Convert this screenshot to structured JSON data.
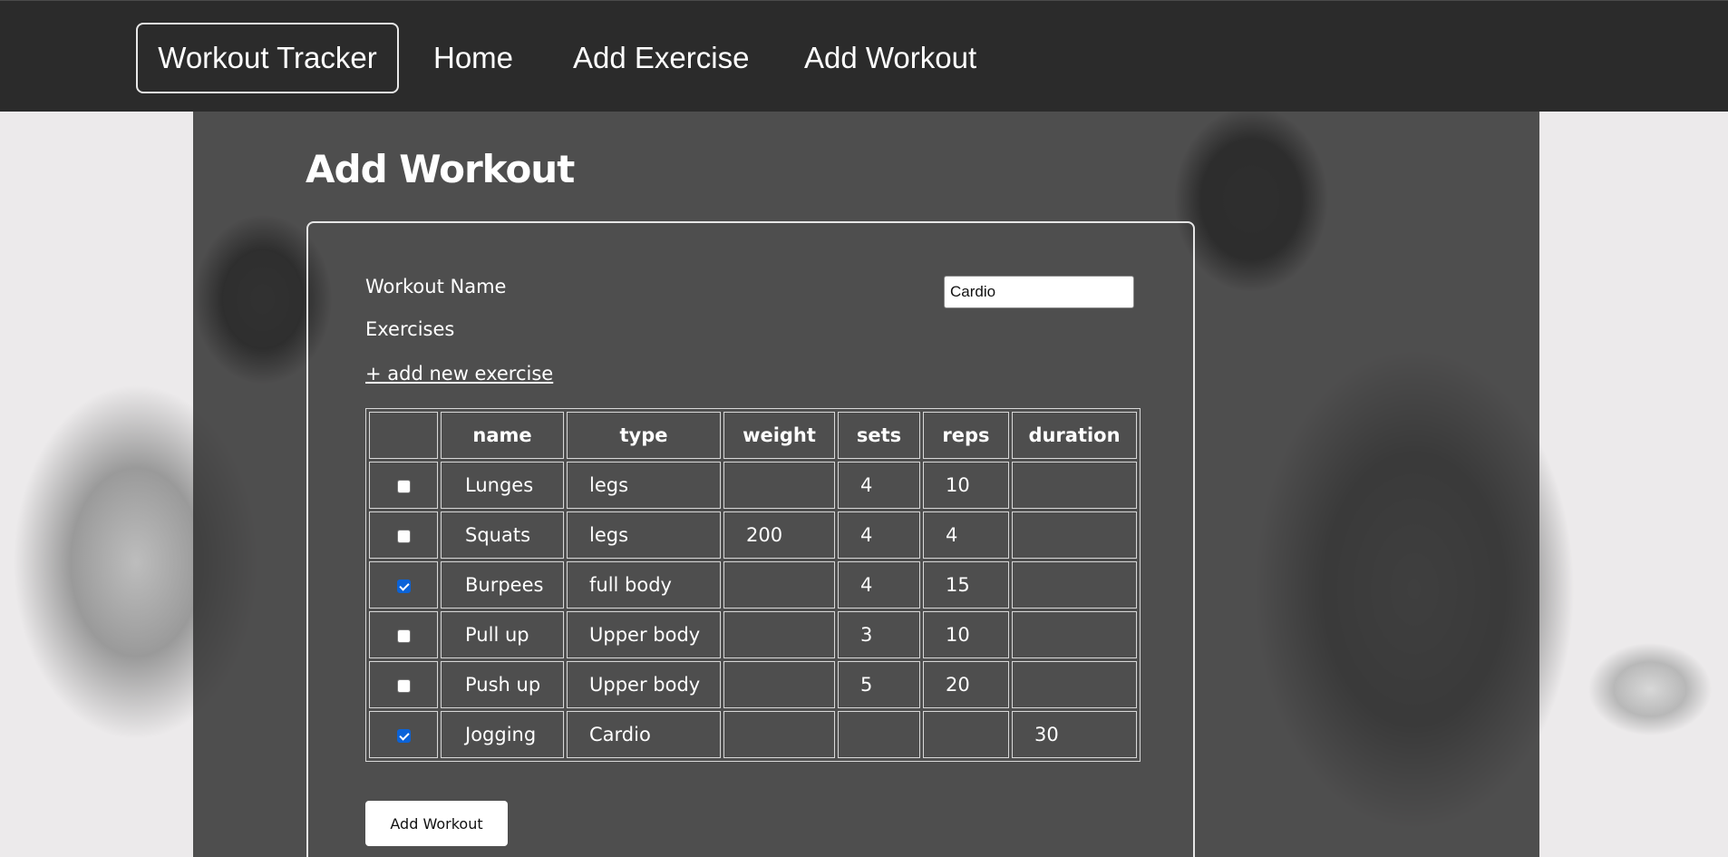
{
  "nav": {
    "brand": "Workout Tracker",
    "links": [
      {
        "label": "Home"
      },
      {
        "label": "Add Exercise"
      },
      {
        "label": "Add Workout"
      }
    ]
  },
  "page": {
    "title": "Add Workout"
  },
  "form": {
    "workout_name_label": "Workout Name",
    "workout_name_value": "Cardio",
    "exercises_label": "Exercises",
    "add_exercise_link": "+ add new exercise",
    "submit_label": "Add Workout"
  },
  "table": {
    "headers": [
      "",
      "name",
      "type",
      "weight",
      "sets",
      "reps",
      "duration"
    ],
    "rows": [
      {
        "checked": false,
        "name": "Lunges",
        "type": "legs",
        "weight": "",
        "sets": "4",
        "reps": "10",
        "duration": ""
      },
      {
        "checked": false,
        "name": "Squats",
        "type": "legs",
        "weight": "200",
        "sets": "4",
        "reps": "4",
        "duration": ""
      },
      {
        "checked": true,
        "name": "Burpees",
        "type": "full body",
        "weight": "",
        "sets": "4",
        "reps": "15",
        "duration": ""
      },
      {
        "checked": false,
        "name": "Pull up",
        "type": "Upper body",
        "weight": "",
        "sets": "3",
        "reps": "10",
        "duration": ""
      },
      {
        "checked": false,
        "name": "Push up",
        "type": "Upper body",
        "weight": "",
        "sets": "5",
        "reps": "20",
        "duration": ""
      },
      {
        "checked": true,
        "name": "Jogging",
        "type": "Cardio",
        "weight": "",
        "sets": "",
        "reps": "",
        "duration": "30"
      }
    ]
  },
  "colors": {
    "navbar": "#2b2b2b",
    "panel": "#303030",
    "checkbox_checked": "#0b63d8"
  }
}
